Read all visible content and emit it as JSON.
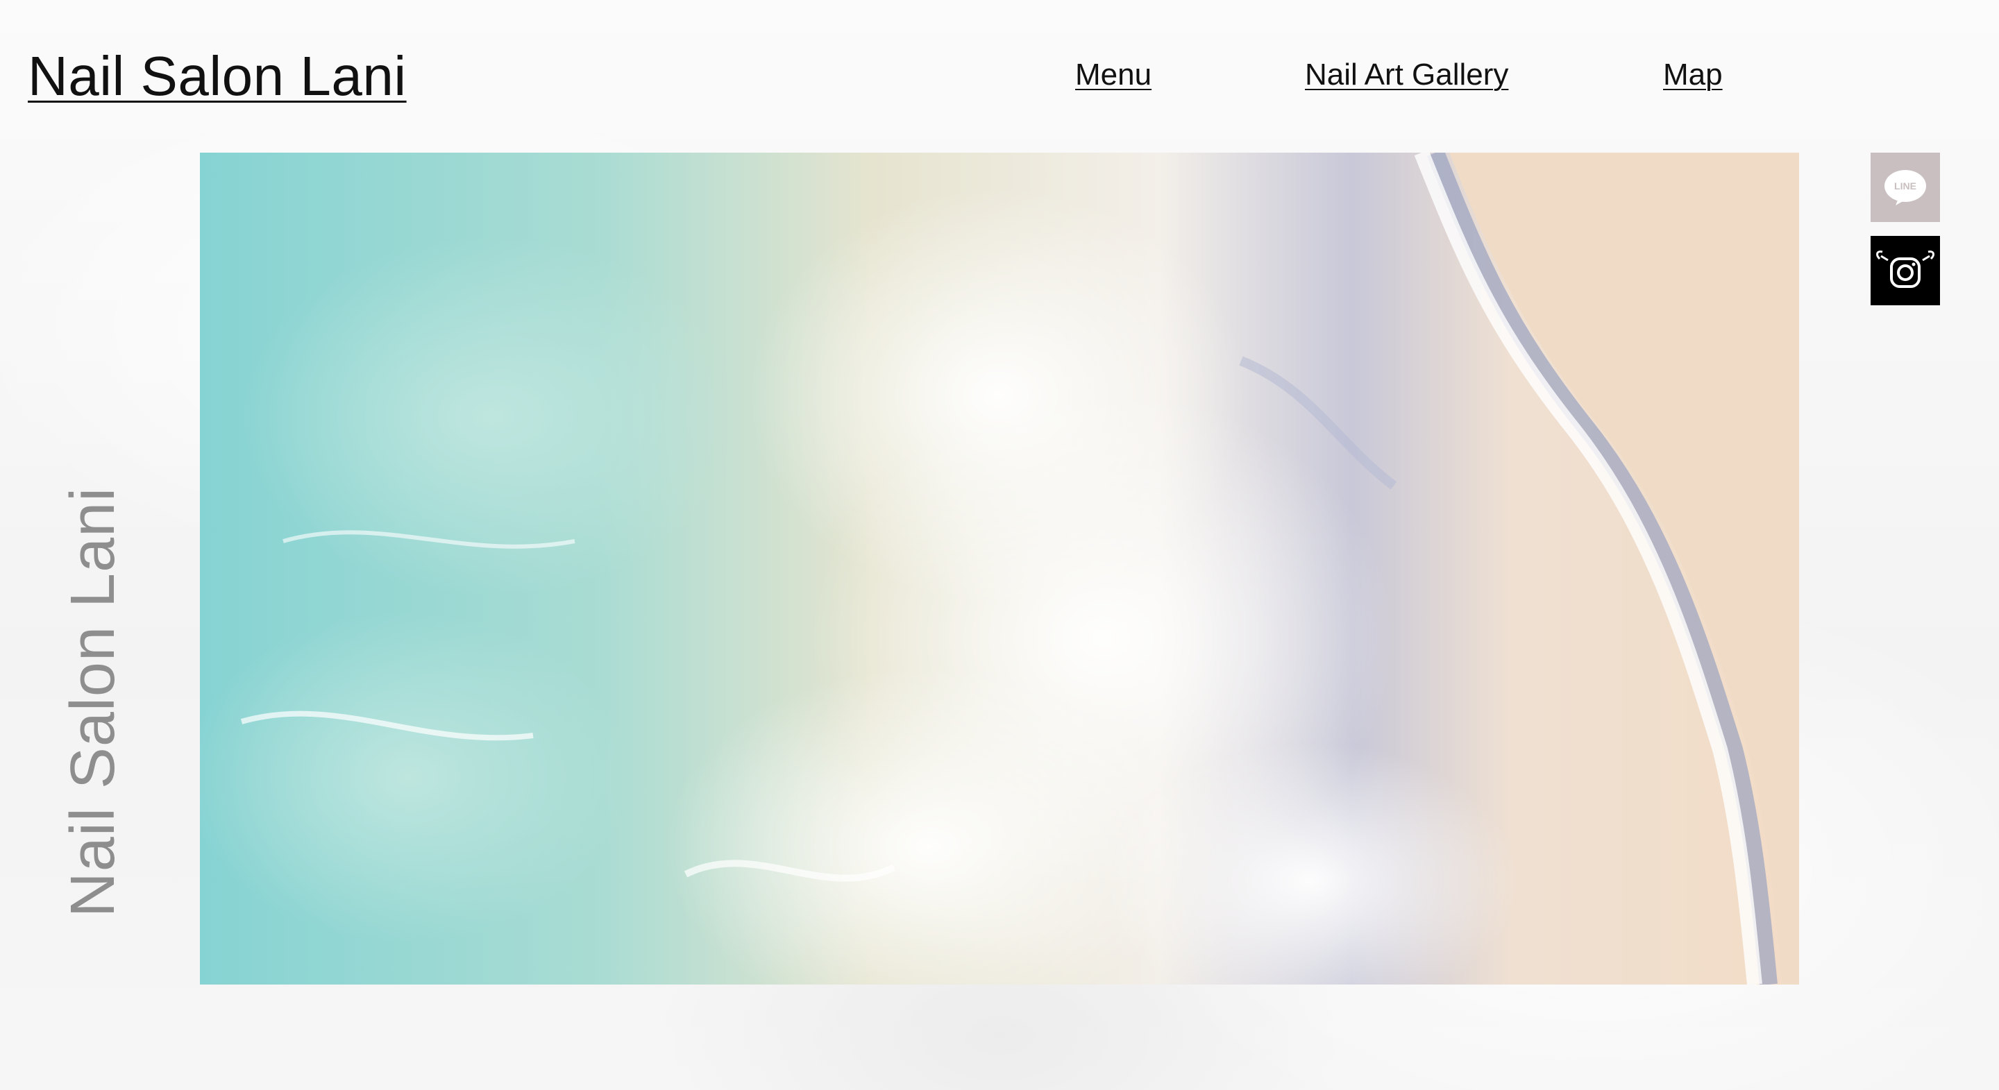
{
  "header": {
    "title": "Nail Salon Lani"
  },
  "nav": {
    "items": [
      {
        "label": "Menu"
      },
      {
        "label": "Nail Art Gallery"
      },
      {
        "label": "Map"
      }
    ]
  },
  "side": {
    "vertical_title": "Nail Salon Lani"
  },
  "hero": {
    "image": "beach-waves-photo"
  },
  "social": {
    "line": {
      "icon": "line-icon",
      "label": "LINE",
      "bg": "#c9bfc0"
    },
    "instagram": {
      "icon": "instagram-icon",
      "bg": "#000000"
    }
  },
  "colors": {
    "text": "#111111",
    "vertical_text": "#8e8e8e",
    "sea": "#7fcfd0",
    "sand": "#f2dcc8"
  }
}
